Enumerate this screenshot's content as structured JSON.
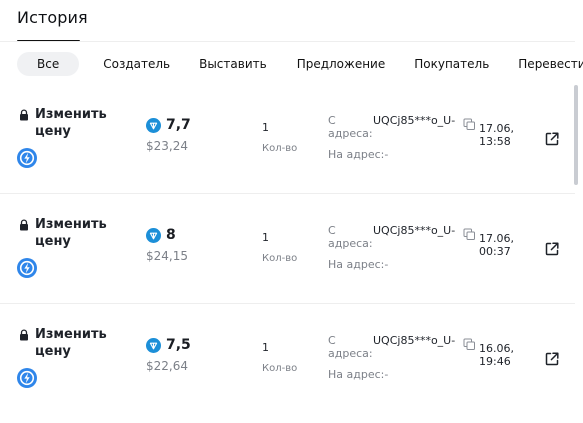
{
  "header": {
    "title": "История"
  },
  "filters": [
    {
      "label": "Все",
      "active": true
    },
    {
      "label": "Создатель",
      "active": false
    },
    {
      "label": "Выставить",
      "active": false
    },
    {
      "label": "Предложение",
      "active": false
    },
    {
      "label": "Покупатель",
      "active": false
    },
    {
      "label": "Перевести",
      "active": false
    }
  ],
  "rows": [
    {
      "event": "Изменить цену",
      "price_ton": "7,7",
      "price_usd": "$23,24",
      "quantity": "1",
      "quantity_label": "Кол-во",
      "from_label": "С адреса:",
      "from_value": "UQCj85***o_U-",
      "to_label": "На адрес:",
      "to_value": "-",
      "date": "17.06,",
      "time": "13:58"
    },
    {
      "event": "Изменить цену",
      "price_ton": "8",
      "price_usd": "$24,15",
      "quantity": "1",
      "quantity_label": "Кол-во",
      "from_label": "С адреса:",
      "from_value": "UQCj85***o_U-",
      "to_label": "На адрес:",
      "to_value": "-",
      "date": "17.06,",
      "time": "00:37"
    },
    {
      "event": "Изменить цену",
      "price_ton": "7,5",
      "price_usd": "$22,64",
      "quantity": "1",
      "quantity_label": "Кол-во",
      "from_label": "С адреса:",
      "from_value": "UQCj85***o_U-",
      "to_label": "На адрес:",
      "to_value": "-",
      "date": "16.06,",
      "time": "19:46"
    }
  ],
  "icons": {
    "lock": "lock-icon",
    "avatar": "lightning-avatar-icon",
    "ton": "ton-icon",
    "copy": "copy-icon",
    "external": "external-link-icon"
  },
  "colors": {
    "accent_blue": "#2f86ea",
    "ton_blue": "#1c8fd8",
    "muted_text": "#7c8088",
    "divider": "#eeeeee"
  }
}
